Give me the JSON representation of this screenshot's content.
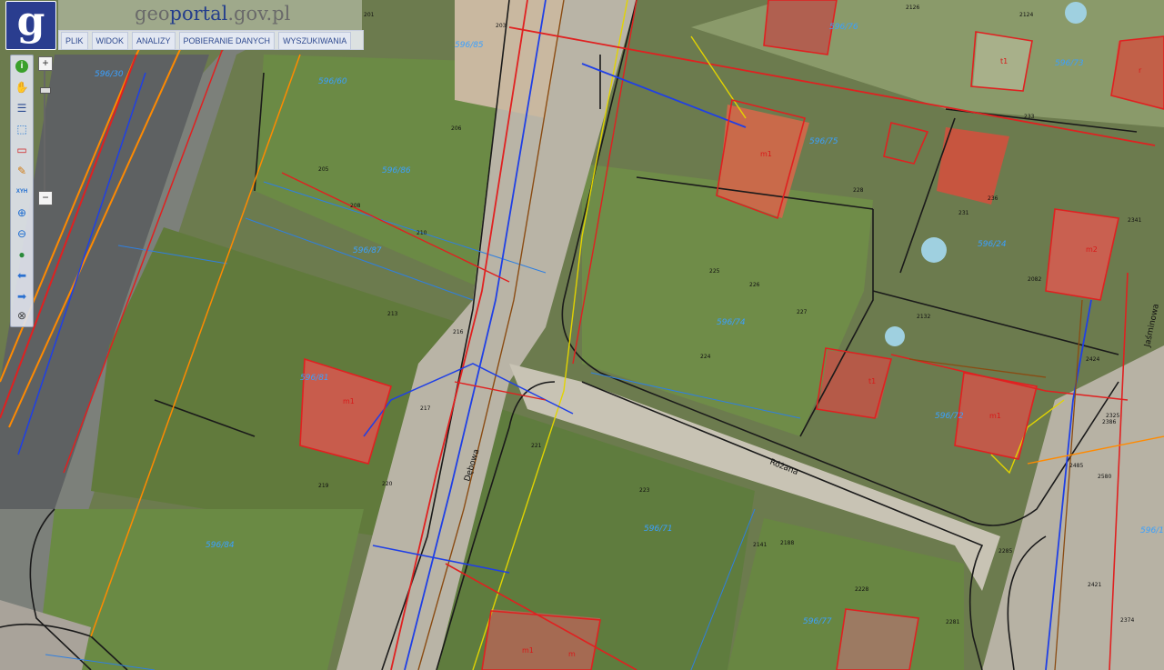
{
  "app": {
    "logo_letter": "g",
    "title_prefix": "geo",
    "title_main": "portal",
    "title_suffix": ".gov.pl"
  },
  "menu": [
    {
      "label": "PLIK"
    },
    {
      "label": "WIDOK"
    },
    {
      "label": "ANALIZY"
    },
    {
      "label": "POBIERANIE DANYCH"
    },
    {
      "label": "WYSZUKIWANIA"
    }
  ],
  "tools": [
    {
      "name": "info-icon",
      "glyph": "i"
    },
    {
      "name": "pan-hand-icon",
      "glyph": "✋"
    },
    {
      "name": "legend-icon",
      "glyph": "☰"
    },
    {
      "name": "select-area-icon",
      "glyph": "⬚"
    },
    {
      "name": "select-rect-red-icon",
      "glyph": "▭"
    },
    {
      "name": "draw-pencil-icon",
      "glyph": "✎"
    },
    {
      "name": "xy-coordinates-icon",
      "glyph": "XYH"
    },
    {
      "name": "zoom-in-icon",
      "glyph": "⊕"
    },
    {
      "name": "zoom-out-icon",
      "glyph": "⊖"
    },
    {
      "name": "full-extent-globe-icon",
      "glyph": "●"
    },
    {
      "name": "back-arrow-icon",
      "glyph": "⬅"
    },
    {
      "name": "forward-arrow-icon",
      "glyph": "➡"
    },
    {
      "name": "clear-icon",
      "glyph": "⊗"
    }
  ],
  "zoom": {
    "plus": "+",
    "minus": "−",
    "level": 0.86
  },
  "colors": {
    "parcel_line": "#1a1a1a",
    "building_red": "#e02020",
    "utility_blue": "#1f3fe6",
    "utility_orange": "#ff8a00",
    "utility_brown": "#8a4b12",
    "utility_yellow": "#e2d400",
    "parcel_label_blue": "#3aa0ff"
  },
  "map": {
    "parcels": [
      {
        "label": "596/85"
      },
      {
        "label": "596/60"
      },
      {
        "label": "596/76"
      },
      {
        "label": "596/73"
      },
      {
        "label": "596/75"
      },
      {
        "label": "596/86"
      },
      {
        "label": "596/87"
      },
      {
        "label": "596/74"
      },
      {
        "label": "596/24"
      },
      {
        "label": "596/81"
      },
      {
        "label": "596/72"
      },
      {
        "label": "596/71"
      },
      {
        "label": "596/84"
      },
      {
        "label": "596/77"
      },
      {
        "label": "596/30"
      },
      {
        "label": "596/1"
      }
    ],
    "buildings": [
      "m1",
      "m1",
      "t1",
      "m2",
      "t1",
      "m1",
      "m1",
      "m",
      "r"
    ],
    "streets": [
      "Różana",
      "Dębowa",
      "Jaśminowa"
    ],
    "points": [
      "201",
      "203",
      "206",
      "205",
      "208",
      "210",
      "213",
      "216",
      "217",
      "219",
      "220",
      "221",
      "223",
      "224",
      "225",
      "226",
      "227",
      "228",
      "231",
      "233",
      "236",
      "2124",
      "2126",
      "2341",
      "2082",
      "2132",
      "2141",
      "2188",
      "2228",
      "2281",
      "2285",
      "2325",
      "2485",
      "2580",
      "2374",
      "2421",
      "2424",
      "2386"
    ]
  }
}
